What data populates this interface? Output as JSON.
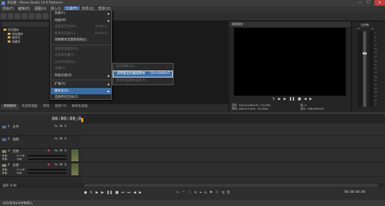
{
  "window": {
    "title": "未标题 - Movie Studio 14.0 Platinum",
    "controls": [
      "—",
      "□",
      "×"
    ]
  },
  "menu": [
    "项目(F)",
    "编辑(E)",
    "视图(V)",
    "插入(I)",
    "工具(T)",
    "选项(O)",
    "帮助(H)"
  ],
  "dropdown": {
    "items": [
      {
        "label": "效果(F)",
        "dim": false,
        "arrow": true
      },
      {
        "label": "动画(M)",
        "dim": false,
        "arrow": true
      },
      {
        "label": "速度和音调(M)...",
        "dim": true,
        "shortcut": "Shift+V"
      },
      {
        "label": "使用生成器(G)...",
        "dim": true,
        "shortcut": "Shift+G"
      },
      {
        "label": "调整整体音量和视频(J)...",
        "dim": false
      },
      {
        "label": "视频合成程序(S)...",
        "dim": true
      },
      {
        "label": "文本和字幕(T)...",
        "dim": true
      },
      {
        "label": "立体声音频(S)...",
        "dim": true
      },
      {
        "label": "字幕(O)",
        "dim": true
      },
      {
        "label": "刻录光盘(B)",
        "dim": false,
        "arrow": true
      },
      {
        "label": "扩展(X)",
        "dim": false,
        "arrow": true
      },
      {
        "label": "脚本化(S)",
        "dim": false,
        "arrow": true,
        "selected": true
      },
      {
        "label": "选择所有活动(Z)",
        "dim": false
      }
    ]
  },
  "submenu": {
    "items": [
      {
        "label": "运行脚本(O)...",
        "dim": true
      },
      {
        "label": "调用最近的编程脚本",
        "dim": false,
        "shortcut": "Ctrl+Shift+F",
        "selected": true
      },
      {
        "label": "重新扫描脚本菜单(R)",
        "dim": true
      }
    ]
  },
  "explorer": {
    "tree": [
      "项目媒体",
      "所有媒体",
      "媒体包",
      "收藏夹"
    ]
  },
  "preview": {
    "title": "视频预览",
    "info_left": [
      "项目: 1920x1080x32, 25.000i",
      "预览: 480x270x32, 25.000p"
    ],
    "info_right": [
      "帧: 0",
      "显示: 498x280x32"
    ]
  },
  "master": {
    "title": "主控制",
    "levels": [
      "-Inf.",
      "-Inf."
    ],
    "scale": [
      "3",
      "6",
      "9",
      "12",
      "15",
      "18",
      "21",
      "24",
      "27",
      "30",
      "33",
      "36",
      "39",
      "42",
      "45",
      "48",
      "51",
      "54",
      "57"
    ]
  },
  "tabs": [
    "项目媒体",
    "资源管理器",
    "转场",
    "视频 FX",
    "媒体生成器"
  ],
  "timeline": {
    "timecode": "00:00:00;00",
    "tracks": [
      {
        "number": "1",
        "name": "文字",
        "type": "video"
      },
      {
        "number": "2",
        "name": "视频",
        "type": "video"
      },
      {
        "number": "3",
        "name": "音频",
        "type": "audio",
        "volume_label": "音量:",
        "volume": "0.0 dB",
        "pan_label": "声像:",
        "pan": "中间"
      },
      {
        "number": "4",
        "name": "背景",
        "type": "audio",
        "volume_label": "音量:",
        "volume": "0.0 dB",
        "pan_label": "声像:",
        "pan": "中间"
      }
    ],
    "track_buttons": [
      "fx",
      "M",
      "S"
    ],
    "rate": "速率: 0.00",
    "end_time": "00:00:00;00"
  },
  "status": {
    "text": "启用/禁用自动修整模式。"
  },
  "colors": {
    "highlight": "#3a6ea5",
    "timeline_marker": "#e0a800",
    "video_header": "#4f6aa0",
    "audio_header": "#7a8a6a"
  }
}
